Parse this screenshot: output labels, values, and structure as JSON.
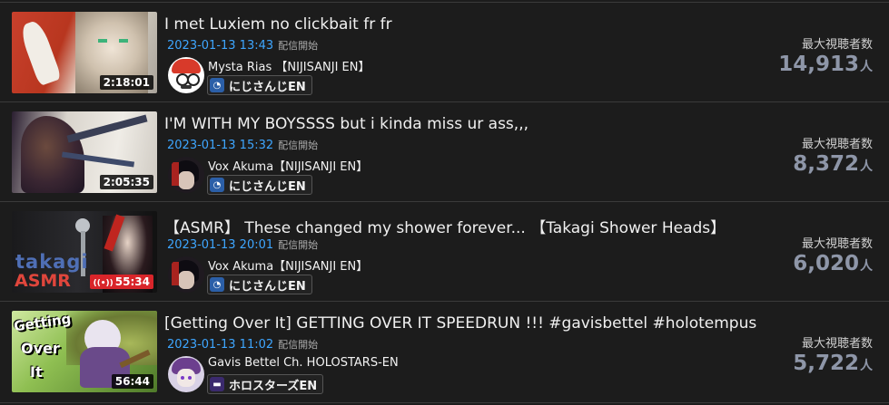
{
  "viewers_label": "最大視聴者数",
  "viewers_unit": "人",
  "streams": [
    {
      "title": "I met Luxiem no clickbait fr fr",
      "date": "2023-01-13 13:43",
      "status": "配信開始",
      "channel": "Mysta Rias 【NIJISANJI EN】",
      "org": "にじさんじEN",
      "duration": "2:18:01",
      "viewers": "14,913"
    },
    {
      "title": "I'M WITH MY BOYSSSS but i kinda miss ur ass,,,",
      "date": "2023-01-13 15:32",
      "status": "配信開始",
      "channel": "Vox Akuma【NIJISANJI EN】",
      "org": "にじさんじEN",
      "duration": "2:05:35",
      "viewers": "8,372"
    },
    {
      "title": "【ASMR】 These changed my shower forever... 【Takagi Shower Heads】",
      "date": "2023-01-13 20:01",
      "status": "配信開始",
      "channel": "Vox Akuma【NIJISANJI EN】",
      "org": "にじさんじEN",
      "duration": "55:34",
      "live_icon": "((•))",
      "thumb_text_1": "takagi",
      "thumb_text_2": "ASMR",
      "viewers": "6,020"
    },
    {
      "title": "[Getting Over It] GETTING OVER IT SPEEDRUN !!! #gavisbettel #holotempus",
      "date": "2023-01-13 11:02",
      "status": "配信開始",
      "channel": "Gavis Bettel Ch. HOLOSTARS-EN",
      "org": "ホロスターズEN",
      "duration": "56:44",
      "thumb_text_1": "Getting",
      "thumb_text_2": "Over",
      "thumb_text_3": "It",
      "viewers": "5,722"
    }
  ]
}
